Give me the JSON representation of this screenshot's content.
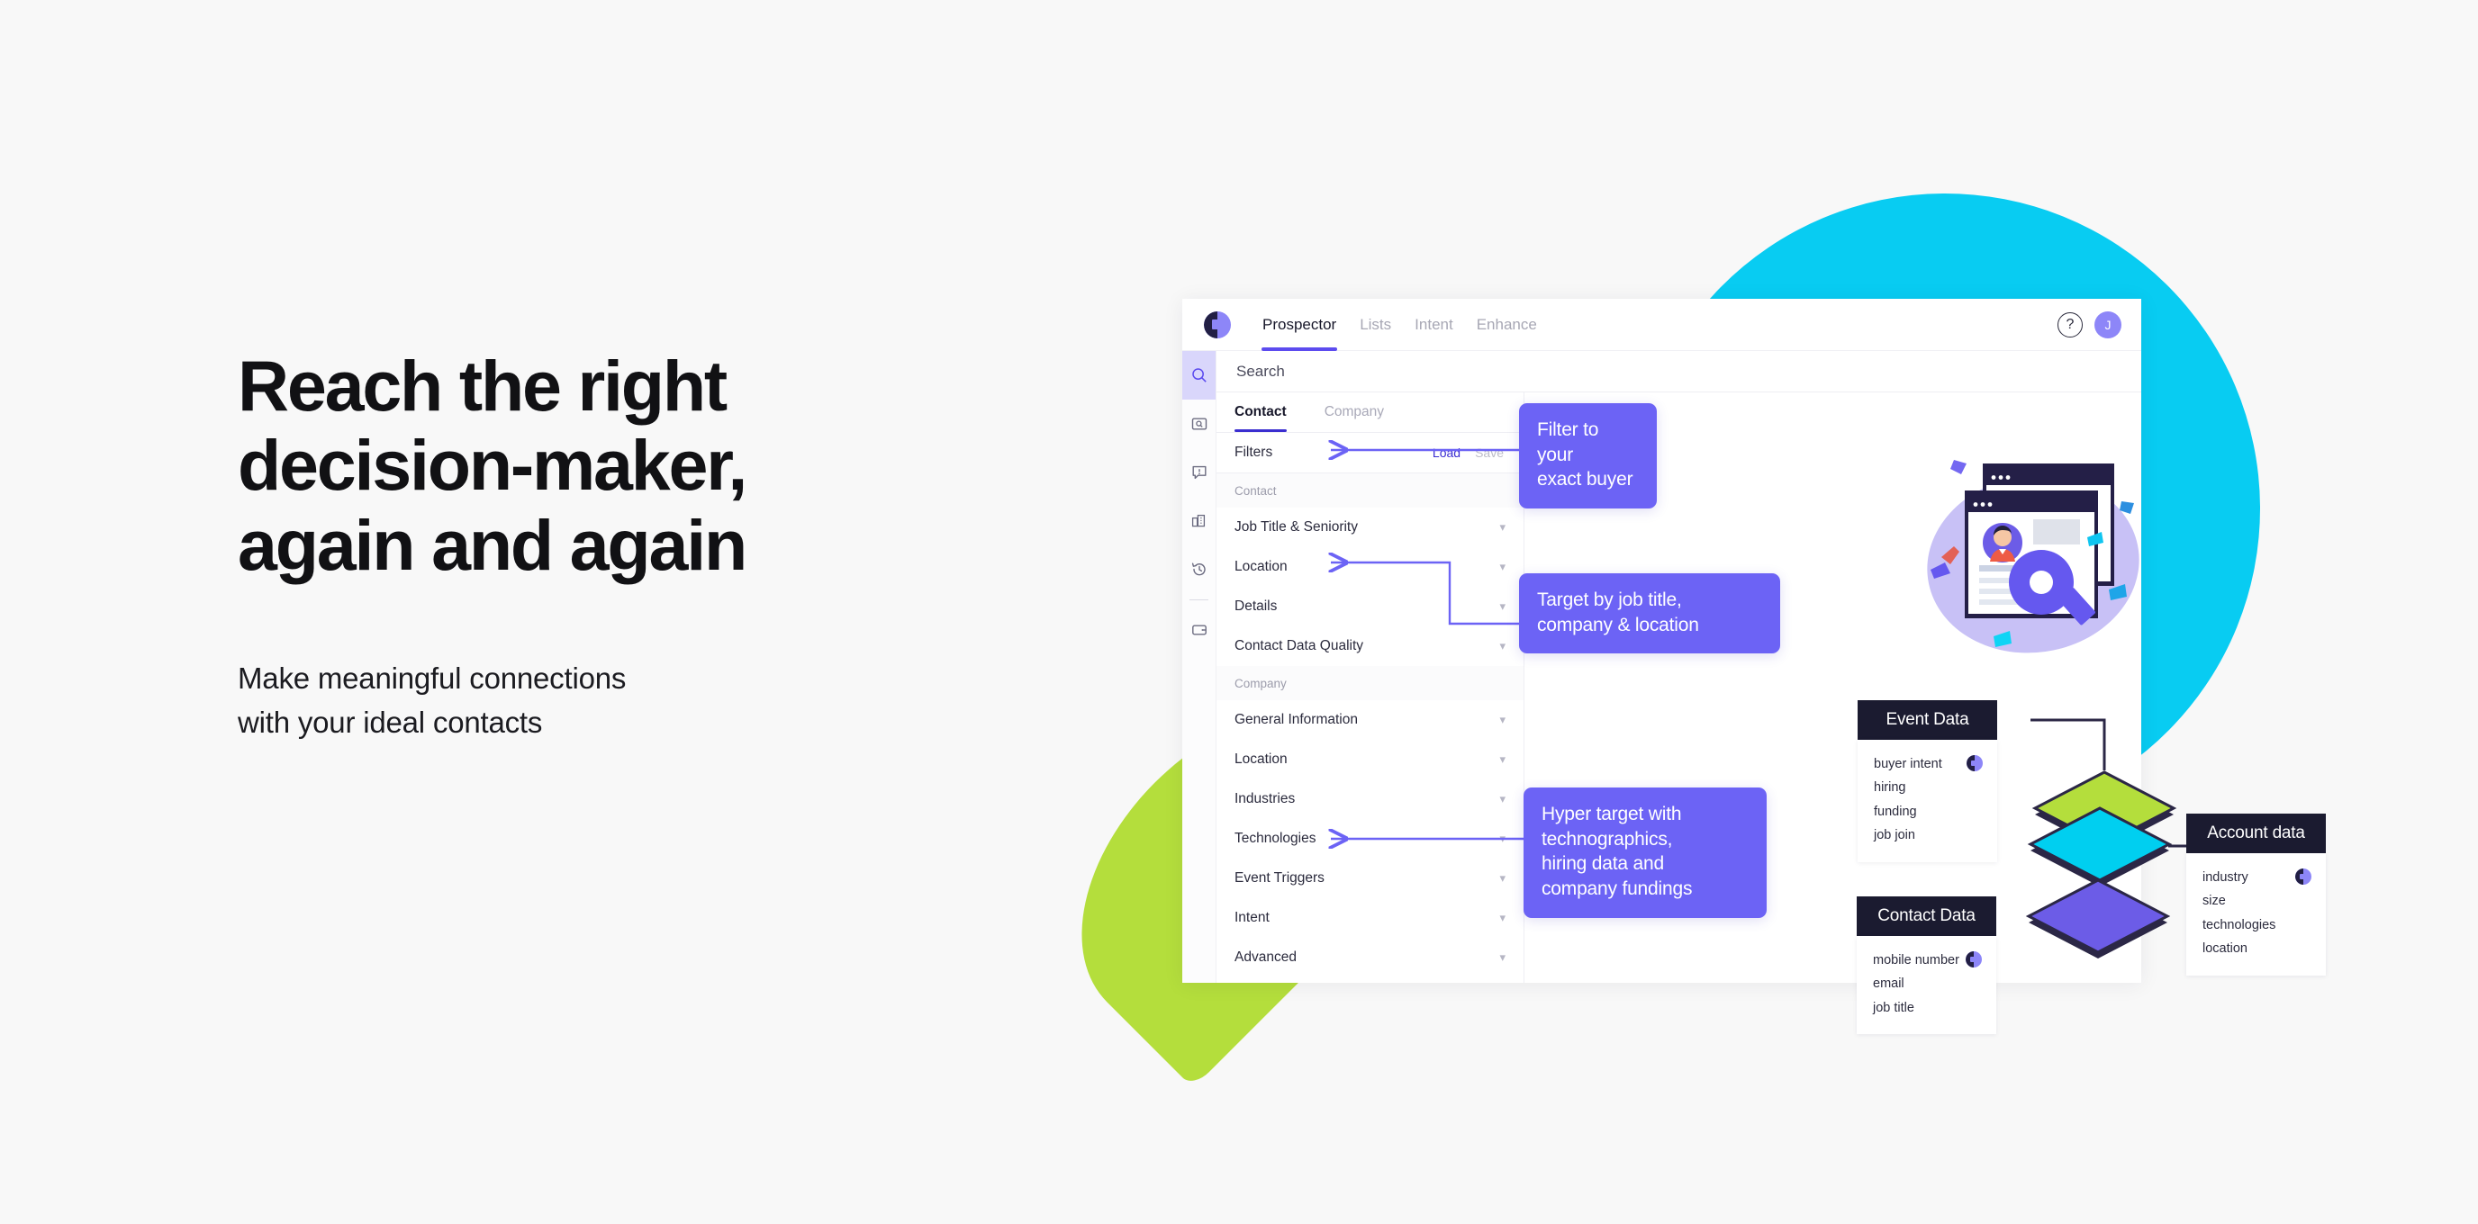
{
  "hero": {
    "headline": "Reach the right\ndecision-maker,\nagain and again",
    "subcopy": "Make meaningful connections\nwith your ideal contacts"
  },
  "colors": {
    "page_bg": "#f8f8f8",
    "accent_purple": "#6C63F5",
    "brand_indigo": "#5C4BEF",
    "blob_cyan": "#08CCF2",
    "blob_green": "#B4DE3C",
    "card_dark": "#1b1b30",
    "diamond_green": "#B4DE3C",
    "diamond_cyan": "#00CFF0",
    "diamond_purple": "#6C5CE7"
  },
  "app": {
    "logo_name": "brand-logo",
    "nav": [
      {
        "label": "Prospector",
        "active": true
      },
      {
        "label": "Lists",
        "active": false
      },
      {
        "label": "Intent",
        "active": false
      },
      {
        "label": "Enhance",
        "active": false
      }
    ],
    "help_label": "?",
    "avatar_initial": "J",
    "search_placeholder": "Search",
    "rail": [
      {
        "icon": "search-icon",
        "active": true
      },
      {
        "icon": "folder-search-icon",
        "active": false
      },
      {
        "icon": "alert-comment-icon",
        "active": false
      },
      {
        "icon": "building-icon",
        "active": false
      },
      {
        "icon": "history-icon",
        "active": false
      },
      {
        "icon": "wallet-icon",
        "active": false
      }
    ],
    "segments": [
      {
        "label": "Contact",
        "active": true
      },
      {
        "label": "Company",
        "active": false
      }
    ],
    "filters_header": {
      "title": "Filters",
      "load_label": "Load",
      "save_label": "Save"
    },
    "filter_groups": [
      {
        "group": "Contact",
        "rows": [
          {
            "label": "Job Title & Seniority"
          },
          {
            "label": "Location"
          },
          {
            "label": "Details"
          },
          {
            "label": "Contact Data Quality"
          }
        ]
      },
      {
        "group": "Company",
        "rows": [
          {
            "label": "General Information"
          },
          {
            "label": "Location"
          },
          {
            "label": "Industries"
          },
          {
            "label": "Technologies"
          },
          {
            "label": "Event Triggers"
          },
          {
            "label": "Intent"
          },
          {
            "label": "Advanced"
          }
        ]
      }
    ]
  },
  "callouts": [
    {
      "id": "callout-1",
      "text": "Filter to your\nexact buyer"
    },
    {
      "id": "callout-2",
      "text": "Target by job title,\ncompany & location"
    },
    {
      "id": "callout-3",
      "text": "Hyper target with\ntechnographics,\nhiring data and\ncompany fundings"
    }
  ],
  "diagram": {
    "cards": [
      {
        "id": "card-event",
        "title": "Event Data",
        "items": [
          "buyer intent",
          "hiring",
          "funding",
          "job join"
        ]
      },
      {
        "id": "card-account",
        "title": "Account data",
        "items": [
          "industry",
          "size",
          "technologies",
          "location"
        ]
      },
      {
        "id": "card-contact",
        "title": "Contact Data",
        "items": [
          "mobile number",
          "email",
          "job title"
        ]
      }
    ],
    "layers": [
      {
        "name": "event-layer",
        "color": "#B4DE3C"
      },
      {
        "name": "account-layer",
        "color": "#00CFF0"
      },
      {
        "name": "contact-layer",
        "color": "#6C5CE7"
      }
    ]
  }
}
